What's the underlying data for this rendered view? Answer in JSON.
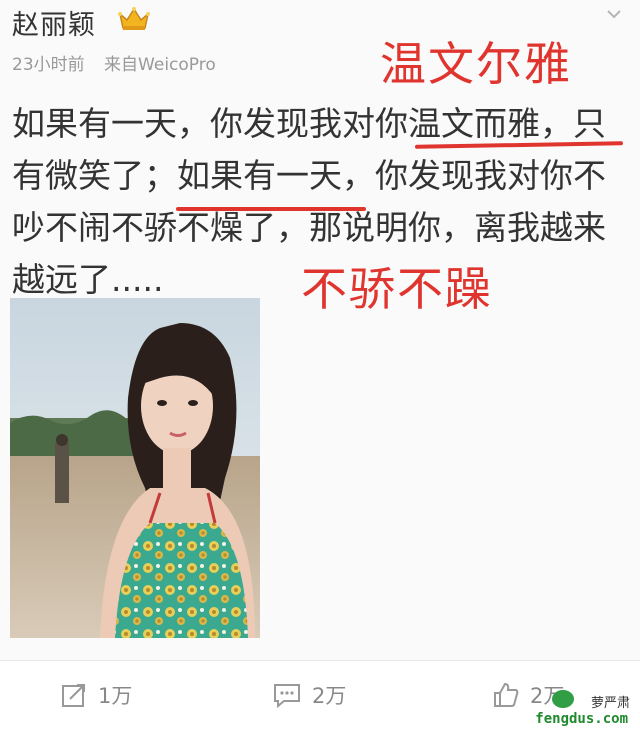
{
  "post": {
    "username": "赵丽颖",
    "time": "23小时前",
    "source": "来自WeicoPro",
    "body": "如果有一天，你发现我对你温文而雅，只有微笑了；如果有一天，你发现我对你不吵不闹不骄不燥了，那说明你，离我越来越远了.....",
    "annotation_1": "温文尔雅",
    "annotation_2": "不骄不躁"
  },
  "footer": {
    "repost_count": "1万",
    "comment_count": "2万",
    "like_count": "2万"
  },
  "watermark": {
    "name": "萝严肃",
    "url": "fengdus.com"
  },
  "colors": {
    "annotation": "#e0352f",
    "text": "#333333",
    "meta": "#999999",
    "crown": "#e8a31a"
  }
}
